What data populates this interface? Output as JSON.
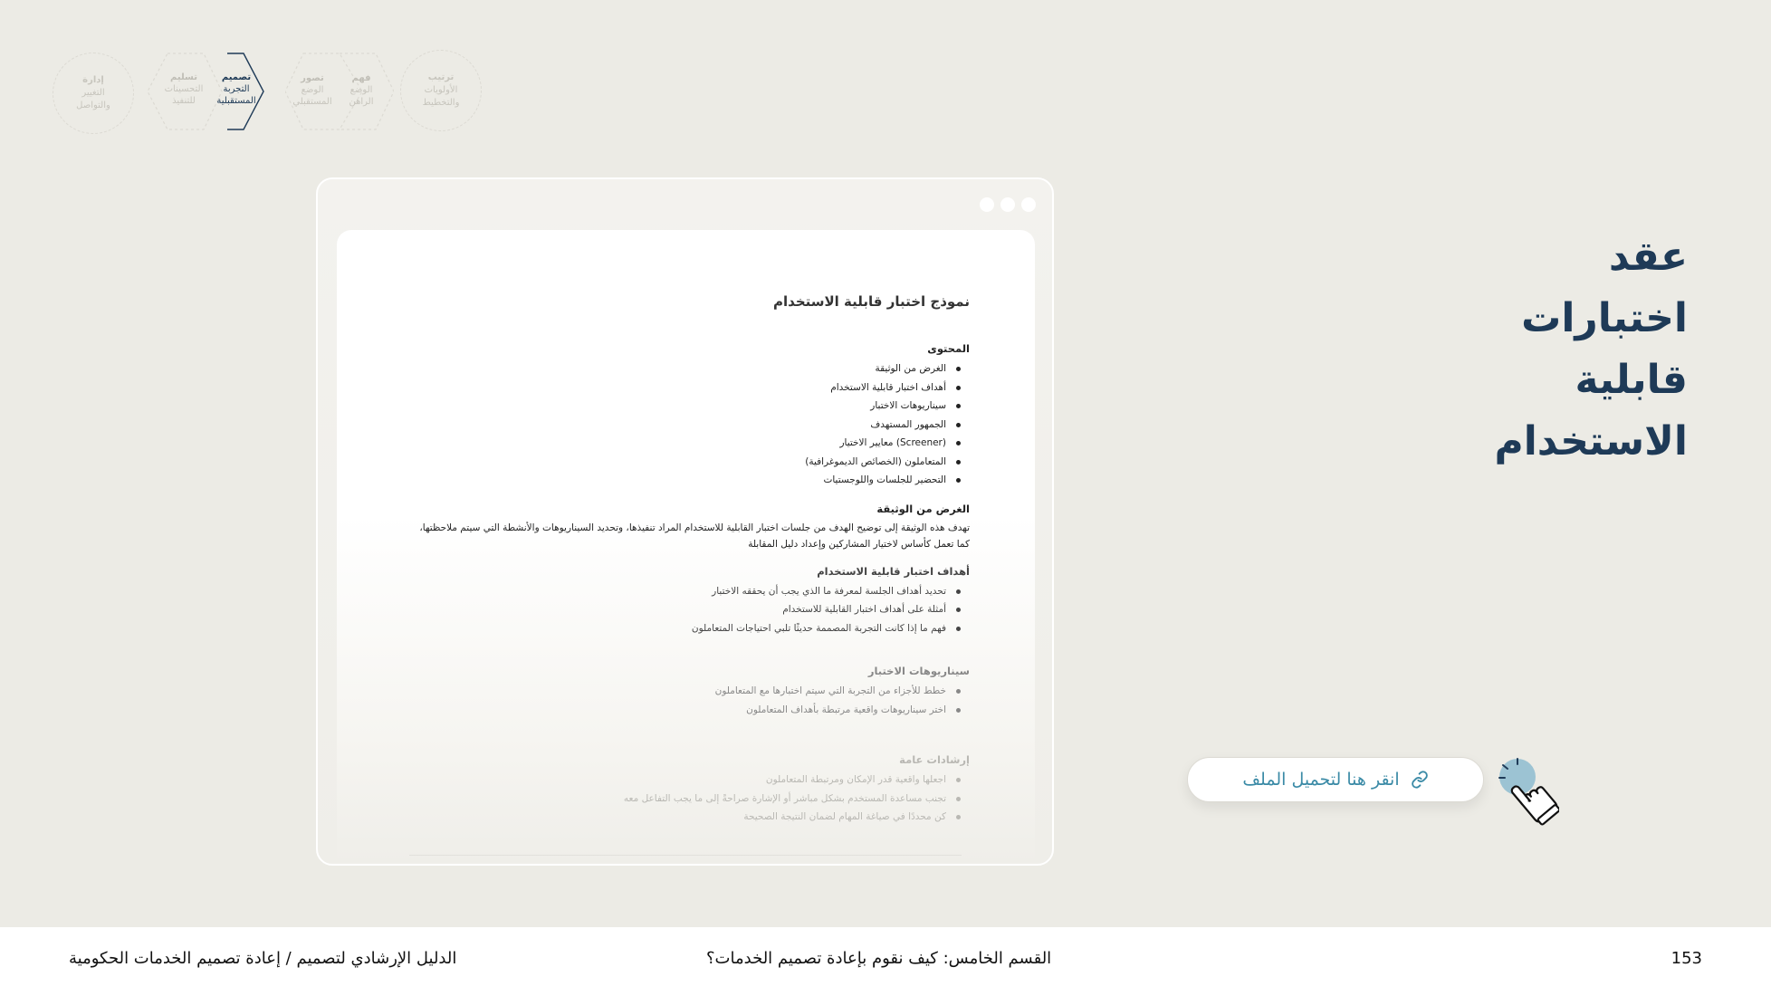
{
  "steps": [
    {
      "title": "ترتيب",
      "lines": [
        "الأولويات",
        "والتخطيط"
      ]
    },
    {
      "title": "فهم",
      "lines": [
        "الوضع",
        "الراهن"
      ]
    },
    {
      "title": "تصور",
      "lines": [
        "الوضع",
        "المستقبلي"
      ]
    },
    {
      "title": "تصميم",
      "lines": [
        "التجربة",
        "المستقبلية"
      ]
    },
    {
      "title": "تسليم",
      "lines": [
        "التحسينات",
        "للتنفيذ"
      ]
    },
    {
      "title": "إدارة",
      "lines": [
        "التغيير",
        "والتواصل"
      ]
    }
  ],
  "document": {
    "title": "نموذج اختبار قابلية الاستخدام",
    "contents_heading": "المحتوى",
    "contents": [
      "الغرض من الوثيقة",
      "أهداف اختبار قابلية الاستخدام",
      "سيناريوهات الاختبار",
      "الجمهور المستهدف",
      "(Screener) معايير الاختيار",
      "المتعاملون (الخصائص الديموغرافية)",
      "التحضير للجلسات واللوجستيات"
    ],
    "purpose_heading": "الغرض من الوثيقة",
    "purpose_text": "تهدف هذه الوثيقة إلى توضيح الهدف من جلسات اختبار القابلية للاستخدام المراد تنفيذها، وتحديد السيناريوهات والأنشطة التي سيتم ملاحظتها، كما تعمل كأساس لاختيار المشاركين وإعداد دليل المقابلة",
    "goals_heading": "أهداف اختبار قابلية الاستخدام",
    "goals": [
      "تحديد أهداف الجلسة لمعرفة ما الذي يجب أن يحققه الاختبار",
      "أمثلة على أهداف اختبار القابلية للاستخدام",
      "فهم ما إذا كانت التجربة المصممة حديثًا تلبي احتياجات المتعاملون"
    ],
    "scenarios_heading": "سيناريوهات الاختبار",
    "scenarios": [
      "خطط للأجزاء من التجربة التي سيتم اختبارها مع  المتعاملون",
      "اختر سيناريوهات واقعية مرتبطة بأهداف المتعاملون"
    ],
    "guidelines_heading": "إرشادات عامة",
    "guidelines": [
      "اجعلها واقعية قدر الإمكان ومرتبطة المتعاملون",
      "تجنب مساعدة المستخدم بشكل مباشر أو الإشارة صراحةً إلى ما يجب التفاعل معه",
      "كن محددًا في صياغة المهام لضمان النتيجة الصحيحة"
    ]
  },
  "heading": {
    "line1": "عقد",
    "line2": "اختبارات",
    "line3": "قابلية",
    "line4": "الاستخدام"
  },
  "download": {
    "label": "انقر هنا لتحميل الملف",
    "icon": "link-icon"
  },
  "footer": {
    "guide_title": "الدليل الإرشادي لتصميم / إعادة تصميم الخدمات الحكومية",
    "section_title": "القسم الخامس: كيف نقوم بإعادة تصميم الخدمات؟",
    "page_number": "153"
  },
  "colors": {
    "background": "#ecebe5",
    "heading": "#1e3a57",
    "accent": "#3a8aa6"
  }
}
